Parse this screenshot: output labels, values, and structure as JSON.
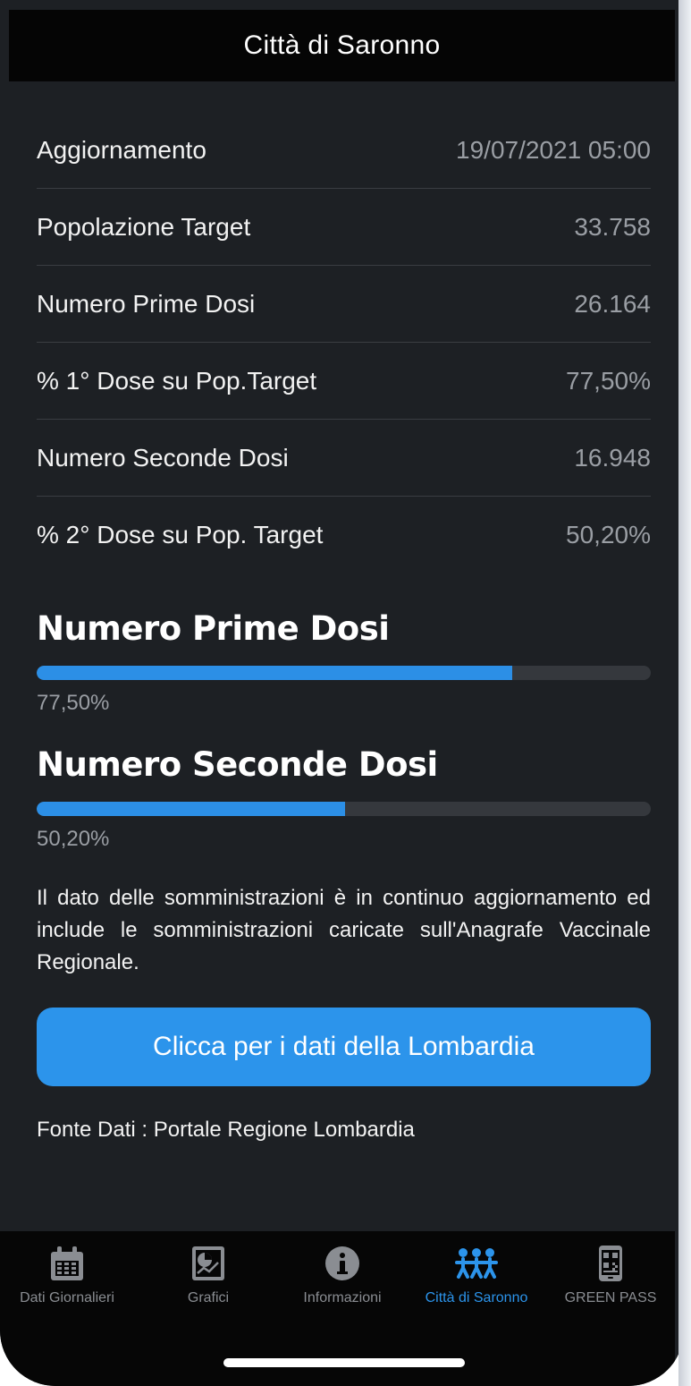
{
  "header": {
    "title": "Città di Saronno"
  },
  "stats": [
    {
      "label": "Aggiornamento",
      "value": "19/07/2021 05:00"
    },
    {
      "label": "Popolazione Target",
      "value": "33.758"
    },
    {
      "label": "Numero Prime Dosi",
      "value": "26.164"
    },
    {
      "label": "% 1° Dose su Pop.Target",
      "value": "77,50%"
    },
    {
      "label": "Numero Seconde Dosi",
      "value": "16.948"
    },
    {
      "label": "% 2° Dose su Pop. Target",
      "value": "50,20%"
    }
  ],
  "progress": [
    {
      "title": "Numero Prime Dosi",
      "percent_label": "77,50%",
      "fraction": 0.775
    },
    {
      "title": "Numero Seconde Dosi",
      "percent_label": "50,20%",
      "fraction": 0.502
    }
  ],
  "note": "Il dato delle somministrazioni è in continuo aggiornamento ed include le somministrazioni caricate sull'Anagrafe Vaccinale Regionale.",
  "button": {
    "label": "Clicca per i dati della Lombardia"
  },
  "source": "Fonte Dati : Portale Regione Lombardia",
  "colors": {
    "accent": "#2c94eb",
    "background": "#1d2024",
    "header": "#050505"
  },
  "tabs": [
    {
      "label": "Dati Giornalieri",
      "icon": "calendar-icon",
      "active": false
    },
    {
      "label": "Grafici",
      "icon": "chart-icon",
      "active": false
    },
    {
      "label": "Informazioni",
      "icon": "info-icon",
      "active": false
    },
    {
      "label": "Città di Saronno",
      "icon": "people-icon",
      "active": true
    },
    {
      "label": "GREEN PASS",
      "icon": "qr-phone-icon",
      "active": false
    }
  ]
}
